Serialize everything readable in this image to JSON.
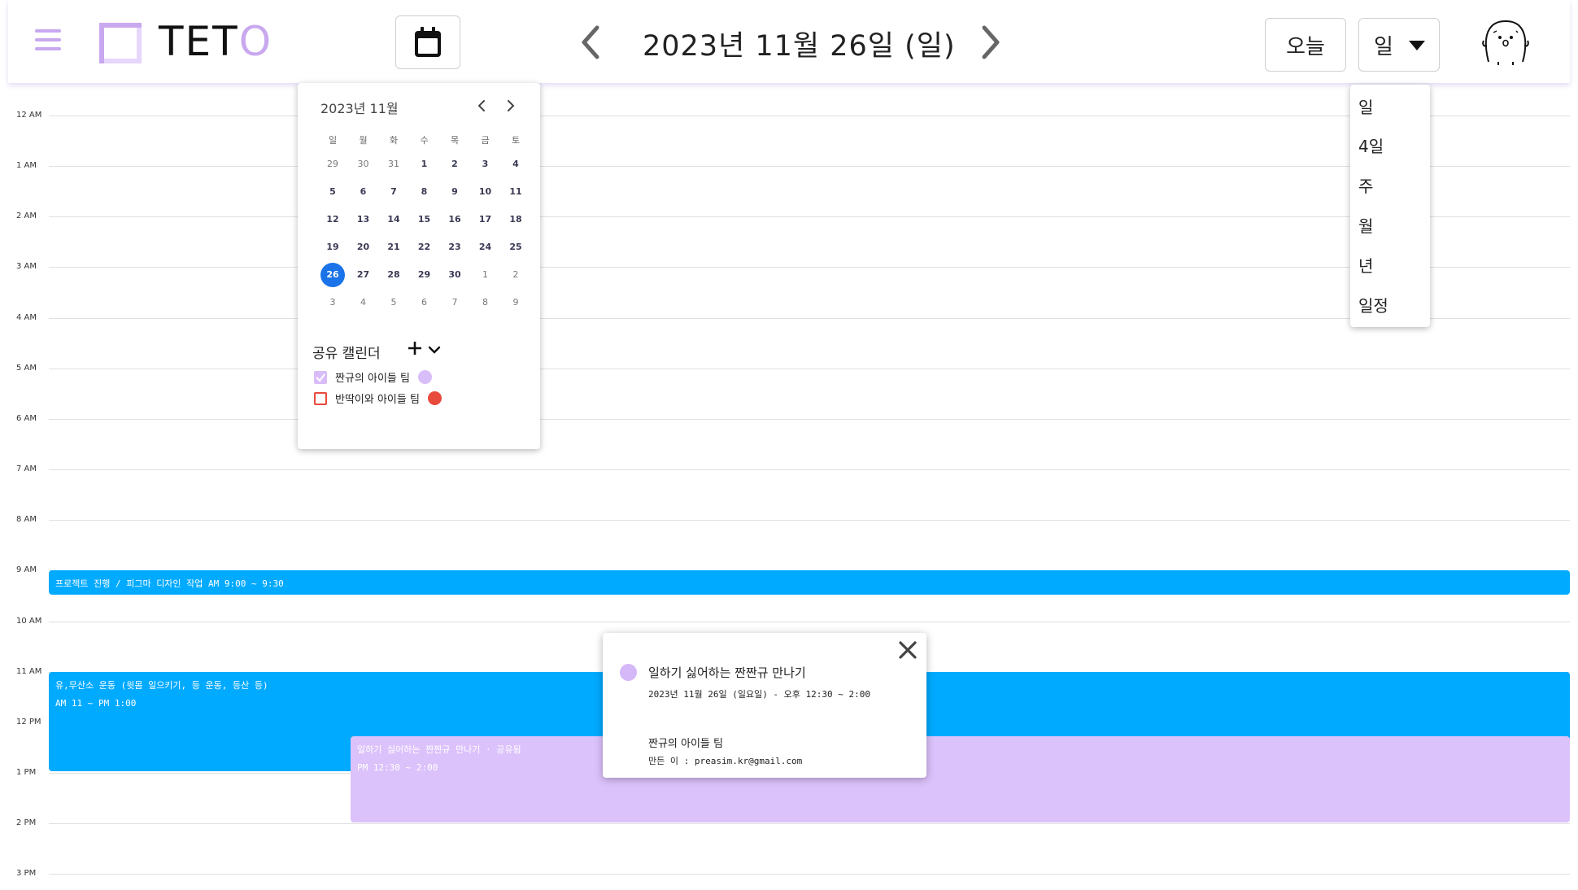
{
  "header": {
    "app_name_main": "TET",
    "app_name_accent": "O",
    "date_title": "2023년  11월  26일  (일)",
    "today_label": "오늘",
    "view_selected": "일"
  },
  "colors": {
    "brand_purple": "#c9a8ef",
    "event_blue": "#00aaff",
    "event_purple": "#dcc2fb",
    "selected_day": "#1a73e8",
    "calendar_red": "#e84a3c"
  },
  "hours": [
    "12 AM",
    "1 AM",
    "2 AM",
    "3 AM",
    "4 AM",
    "5 AM",
    "6 AM",
    "7 AM",
    "8 AM",
    "9 AM",
    "10 AM",
    "11 AM",
    "12 PM",
    "1 PM",
    "2 PM",
    "3 PM"
  ],
  "events": [
    {
      "title": "프로젝트 진행 / 피그마 디자인 작업   AM 9:00 ~ 9:30"
    },
    {
      "title": "유,무산소 운동 (윗몸 일으키기, 등 운동, 등산 등)",
      "time": "AM 11 ~ PM 1:00"
    },
    {
      "title": "일하기 싫어하는 짠짠규 만나기 · 공유됨",
      "time": "PM 12:30 ~ 2:00"
    }
  ],
  "mini_calendar": {
    "title": "2023년 11월",
    "weekdays": [
      "일",
      "월",
      "화",
      "수",
      "목",
      "금",
      "토"
    ],
    "weeks": [
      [
        "29",
        "30",
        "31",
        "1",
        "2",
        "3",
        "4"
      ],
      [
        "5",
        "6",
        "7",
        "8",
        "9",
        "10",
        "11"
      ],
      [
        "12",
        "13",
        "14",
        "15",
        "16",
        "17",
        "18"
      ],
      [
        "19",
        "20",
        "21",
        "22",
        "23",
        "24",
        "25"
      ],
      [
        "26",
        "27",
        "28",
        "29",
        "30",
        "1",
        "2"
      ],
      [
        "3",
        "4",
        "5",
        "6",
        "7",
        "8",
        "9"
      ]
    ],
    "selected_day": "26"
  },
  "shared_calendars": {
    "title": "공유  캘린더",
    "items": [
      {
        "label": "짠규의  아이들  팀",
        "checked": true,
        "color": "#d9bdf9"
      },
      {
        "label": "반딱이와  아이들  팀",
        "checked": false,
        "color": "#e84a3c"
      }
    ]
  },
  "view_options": [
    "일",
    "4일",
    "주",
    "월",
    "년",
    "일정"
  ],
  "popover": {
    "title": "일하기  싫어하는  짠짠규  만나기",
    "datetime": "2023년 11월 26일 (일요일) - 오후 12:30 ~ 2:00",
    "calendar": "짠규의  아이들  팀",
    "creator": "만든 이 : preasim.kr@gmail.com"
  }
}
